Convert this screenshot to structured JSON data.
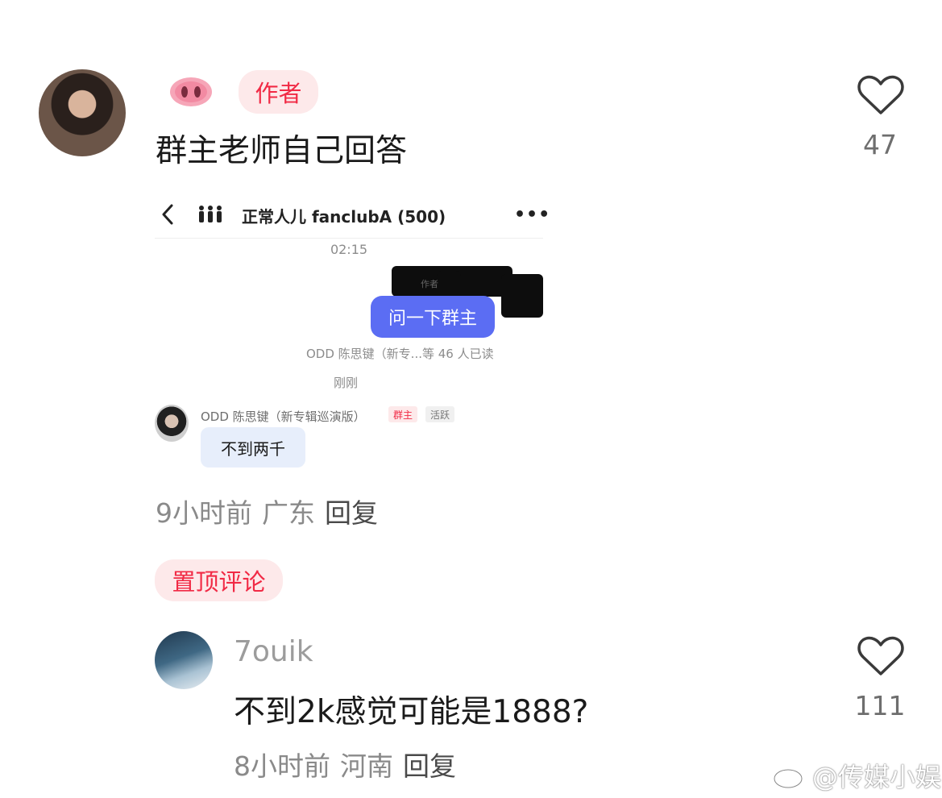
{
  "comment1": {
    "author_badge": "作者",
    "text": "群主老师自己回答",
    "meta": {
      "time": "9小时前",
      "location": "广东",
      "reply": "回复"
    },
    "like_count": "47",
    "attachment": {
      "group_title": "正常人儿 fanclubA (500)",
      "timestamp": "02:15",
      "redacted_hint": "作者",
      "self_message": "问一下群主",
      "read_status": "ODD 陈思键（新专...等 46 人已读",
      "just_now": "刚刚",
      "sender_name": "ODD 陈思键（新专辑巡演版）",
      "sender_tags": [
        "群主",
        "活跃"
      ],
      "reply_message": "不到两千"
    }
  },
  "pinned_label": "置顶评论",
  "comment2": {
    "username": "7ouik",
    "text": "不到2k感觉可能是1888?",
    "meta": {
      "time": "8小时前",
      "location": "河南",
      "reply": "回复"
    },
    "like_count": "111"
  },
  "watermark": "@传媒小娱",
  "colors": {
    "accent_red": "#f12a45",
    "bubble_blue": "#5b6df3",
    "tag_bg": "#fde9ea"
  }
}
